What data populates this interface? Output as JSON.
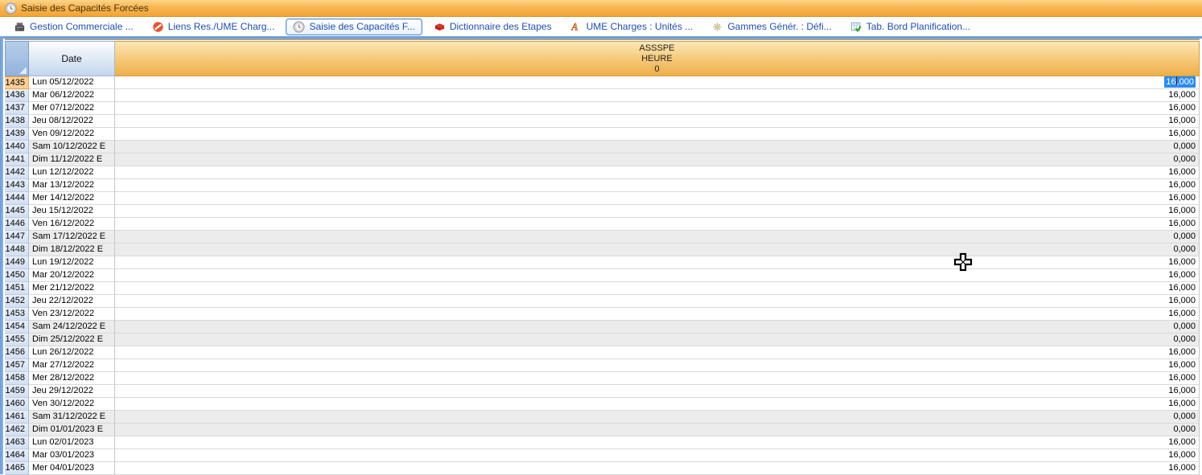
{
  "window": {
    "title": "Saisie des Capacités Forcées"
  },
  "tabs": [
    {
      "name": "gestion-commerciale",
      "label": "Gestion Commerciale ...",
      "icon": "cash-register-icon",
      "selected": false
    },
    {
      "name": "liens-res-ume-charges",
      "label": "Liens Res./UME Charg...",
      "icon": "no-entry-icon",
      "selected": false
    },
    {
      "name": "saisie-capacites-forcees",
      "label": "Saisie des Capacités F...",
      "icon": "clock-icon",
      "selected": true
    },
    {
      "name": "dictionnaire-des-etapes",
      "label": "Dictionnaire des Etapes",
      "icon": "red-book-icon",
      "selected": false
    },
    {
      "name": "ume-charges-unites",
      "label": "UME Charges : Unités ...",
      "icon": "letter-a-icon",
      "selected": false
    },
    {
      "name": "gammes-gener-defi",
      "label": "Gammes Génér. : Défi...",
      "icon": "sparkle-icon",
      "selected": false
    },
    {
      "name": "tab-bord-planification",
      "label": "Tab. Bord Planification...",
      "icon": "planning-check-icon",
      "selected": false
    }
  ],
  "grid": {
    "date_header": "Date",
    "value_header_lines": [
      "ASSSPE",
      "HEURE",
      "0"
    ],
    "selected_cell": {
      "row": "1435",
      "value": "16,000",
      "text_before_caret": "16",
      "text_after_caret": ",000"
    },
    "rows": [
      {
        "num": "1435",
        "date": "Lun 05/12/2022",
        "value": "16,000",
        "weekend": false,
        "active": true
      },
      {
        "num": "1436",
        "date": "Mar 06/12/2022",
        "value": "16,000",
        "weekend": false,
        "active": false
      },
      {
        "num": "1437",
        "date": "Mer 07/12/2022",
        "value": "16,000",
        "weekend": false,
        "active": false
      },
      {
        "num": "1438",
        "date": "Jeu 08/12/2022",
        "value": "16,000",
        "weekend": false,
        "active": false
      },
      {
        "num": "1439",
        "date": "Ven 09/12/2022",
        "value": "16,000",
        "weekend": false,
        "active": false
      },
      {
        "num": "1440",
        "date": "Sam 10/12/2022 E",
        "value": "0,000",
        "weekend": true,
        "active": false
      },
      {
        "num": "1441",
        "date": "Dim 11/12/2022 E",
        "value": "0,000",
        "weekend": true,
        "active": false
      },
      {
        "num": "1442",
        "date": "Lun 12/12/2022",
        "value": "16,000",
        "weekend": false,
        "active": false
      },
      {
        "num": "1443",
        "date": "Mar 13/12/2022",
        "value": "16,000",
        "weekend": false,
        "active": false
      },
      {
        "num": "1444",
        "date": "Mer 14/12/2022",
        "value": "16,000",
        "weekend": false,
        "active": false
      },
      {
        "num": "1445",
        "date": "Jeu 15/12/2022",
        "value": "16,000",
        "weekend": false,
        "active": false
      },
      {
        "num": "1446",
        "date": "Ven 16/12/2022",
        "value": "16,000",
        "weekend": false,
        "active": false
      },
      {
        "num": "1447",
        "date": "Sam 17/12/2022 E",
        "value": "0,000",
        "weekend": true,
        "active": false
      },
      {
        "num": "1448",
        "date": "Dim 18/12/2022 E",
        "value": "0,000",
        "weekend": true,
        "active": false
      },
      {
        "num": "1449",
        "date": "Lun 19/12/2022",
        "value": "16,000",
        "weekend": false,
        "active": false
      },
      {
        "num": "1450",
        "date": "Mar 20/12/2022",
        "value": "16,000",
        "weekend": false,
        "active": false
      },
      {
        "num": "1451",
        "date": "Mer 21/12/2022",
        "value": "16,000",
        "weekend": false,
        "active": false
      },
      {
        "num": "1452",
        "date": "Jeu 22/12/2022",
        "value": "16,000",
        "weekend": false,
        "active": false
      },
      {
        "num": "1453",
        "date": "Ven 23/12/2022",
        "value": "16,000",
        "weekend": false,
        "active": false
      },
      {
        "num": "1454",
        "date": "Sam 24/12/2022 E",
        "value": "0,000",
        "weekend": true,
        "active": false
      },
      {
        "num": "1455",
        "date": "Dim 25/12/2022 E",
        "value": "0,000",
        "weekend": true,
        "active": false
      },
      {
        "num": "1456",
        "date": "Lun 26/12/2022",
        "value": "16,000",
        "weekend": false,
        "active": false
      },
      {
        "num": "1457",
        "date": "Mar 27/12/2022",
        "value": "16,000",
        "weekend": false,
        "active": false
      },
      {
        "num": "1458",
        "date": "Mer 28/12/2022",
        "value": "16,000",
        "weekend": false,
        "active": false
      },
      {
        "num": "1459",
        "date": "Jeu 29/12/2022",
        "value": "16,000",
        "weekend": false,
        "active": false
      },
      {
        "num": "1460",
        "date": "Ven 30/12/2022",
        "value": "16,000",
        "weekend": false,
        "active": false
      },
      {
        "num": "1461",
        "date": "Sam 31/12/2022 E",
        "value": "0,000",
        "weekend": true,
        "active": false
      },
      {
        "num": "1462",
        "date": "Dim 01/01/2023 E",
        "value": "0,000",
        "weekend": true,
        "active": false
      },
      {
        "num": "1463",
        "date": "Lun 02/01/2023",
        "value": "16,000",
        "weekend": false,
        "active": false
      },
      {
        "num": "1464",
        "date": "Mar 03/01/2023",
        "value": "16,000",
        "weekend": false,
        "active": false
      },
      {
        "num": "1465",
        "date": "Mer 04/01/2023",
        "value": "16,000",
        "weekend": false,
        "active": false
      }
    ]
  },
  "colors": {
    "titlebar_orange": "#f6ab3c",
    "header_orange": "#edaf4b",
    "selection_blue": "#2b8cf0",
    "tab_text_blue": "#1d4fae",
    "weekend_gray": "#ececec",
    "active_row_orange": "#fccf95"
  }
}
